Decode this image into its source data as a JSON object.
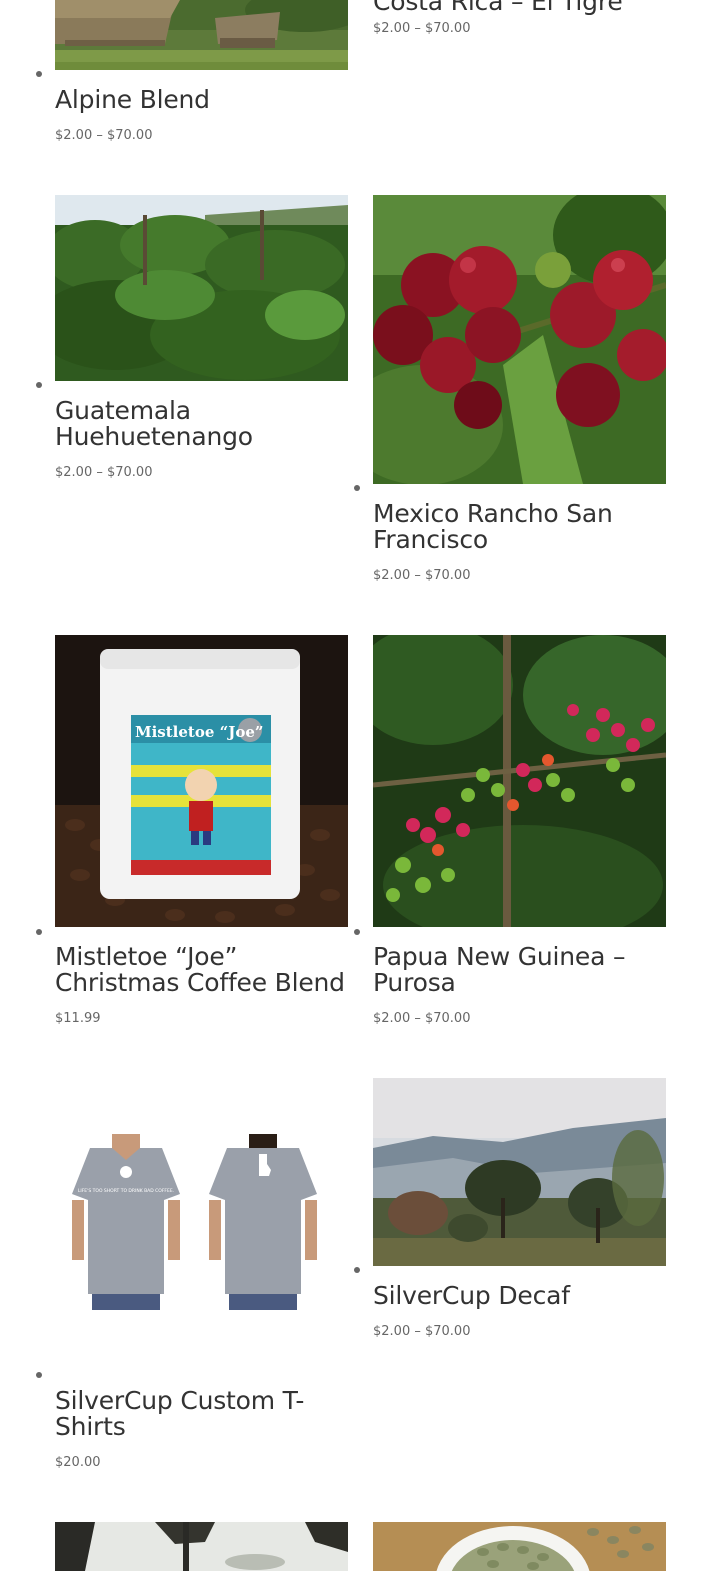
{
  "products": [
    {
      "name": "Costa Rica – El Tigre",
      "price": "$2.00 – $70.00",
      "image": "costa-rica-farm-image"
    },
    {
      "name": "Alpine Blend",
      "price": "$2.00 – $70.00",
      "image": "village-huts-image"
    },
    {
      "name": "Guatemala Huehuetenango",
      "price": "$2.00 – $70.00",
      "image": "coffee-trees-hillside-image"
    },
    {
      "name": "Mexico Rancho San Francisco",
      "price": "$2.00 – $70.00",
      "image": "red-coffee-cherries-image"
    },
    {
      "name": "Mistletoe “Joe” Christmas Coffee Blend",
      "price": "$11.99",
      "image": "coffee-bag-on-beans-image",
      "bag_label": "Mistletoe “Joe”"
    },
    {
      "name": "Papua New Guinea – Purosa",
      "price": "$2.00 – $70.00",
      "image": "coffee-cherries-branch-image"
    },
    {
      "name": "SilverCup Custom T-Shirts",
      "price": "$20.00",
      "image": "grey-tshirt-front-back-image",
      "shirt_text": "LIFE'S TOO SHORT TO DRINK BAD COFFEE."
    },
    {
      "name": "SilverCup Decaf",
      "price": "$2.00 – $70.00",
      "image": "misty-mountain-farm-image"
    },
    {
      "name": "",
      "price": "",
      "image": "silhouette-trees-image"
    },
    {
      "name": "",
      "price": "",
      "image": "green-coffee-beans-bowl-image"
    }
  ],
  "colors": {
    "title": "#333333",
    "price": "#666666",
    "bullet": "#666666"
  }
}
